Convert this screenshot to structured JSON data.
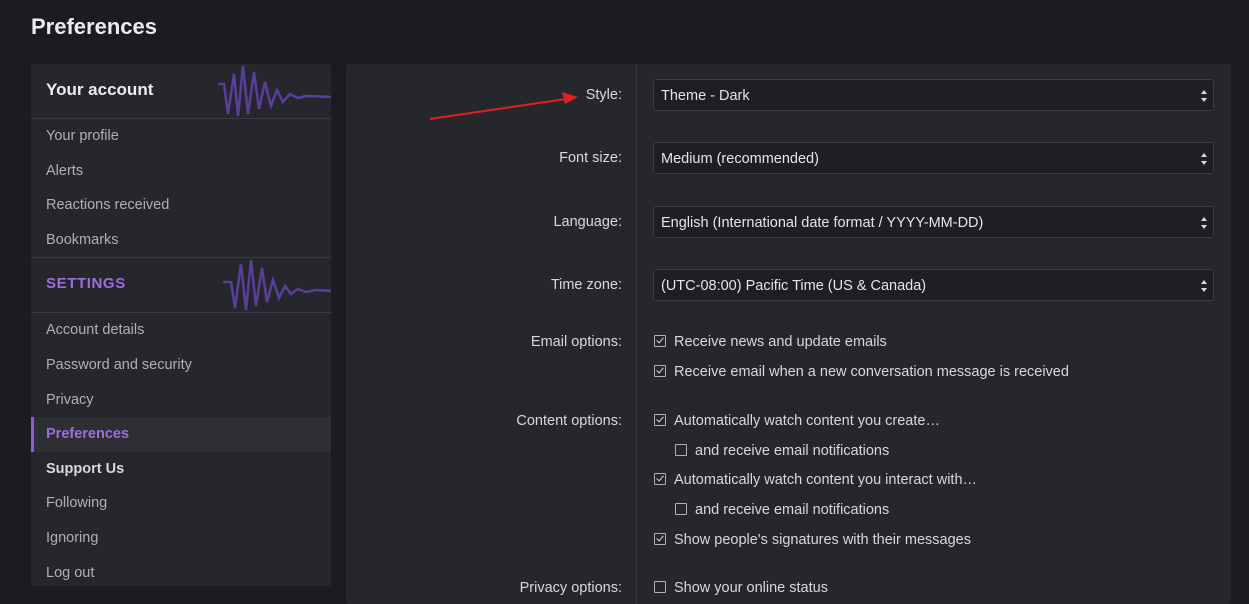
{
  "page": {
    "title": "Preferences"
  },
  "sidebar": {
    "account_heading": "Your account",
    "account_items": [
      {
        "label": "Your profile"
      },
      {
        "label": "Alerts"
      },
      {
        "label": "Reactions received"
      },
      {
        "label": "Bookmarks"
      }
    ],
    "settings_heading": "SETTINGS",
    "settings_items": [
      {
        "label": "Account details"
      },
      {
        "label": "Password and security"
      },
      {
        "label": "Privacy"
      },
      {
        "label": "Preferences",
        "active": true
      },
      {
        "label": "Support Us",
        "bold": true
      },
      {
        "label": "Following"
      },
      {
        "label": "Ignoring"
      },
      {
        "label": "Log out"
      }
    ],
    "accent_color": "#9b6ee0"
  },
  "form": {
    "style": {
      "label": "Style:",
      "value": "Theme - Dark"
    },
    "font_size": {
      "label": "Font size:",
      "value": "Medium (recommended)"
    },
    "language": {
      "label": "Language:",
      "value": "English (International date format / YYYY-MM-DD)"
    },
    "time_zone": {
      "label": "Time zone:",
      "value": "(UTC-08:00) Pacific Time (US & Canada)"
    },
    "email_options": {
      "label": "Email options:",
      "items": [
        {
          "label": "Receive news and update emails",
          "checked": true
        },
        {
          "label": "Receive email when a new conversation message is received",
          "checked": true
        }
      ]
    },
    "content_options": {
      "label": "Content options:",
      "items": [
        {
          "label": "Automatically watch content you create…",
          "checked": true
        },
        {
          "label": "and receive email notifications",
          "checked": false
        },
        {
          "label": "Automatically watch content you interact with…",
          "checked": true
        },
        {
          "label": "and receive email notifications",
          "checked": false
        },
        {
          "label": "Show people's signatures with their messages",
          "checked": true
        }
      ]
    },
    "privacy_options": {
      "label": "Privacy options:",
      "items": [
        {
          "label": "Show your online status",
          "checked": false
        }
      ]
    }
  },
  "annotation": {
    "icon": "red-arrow-icon",
    "color": "#e02020"
  }
}
